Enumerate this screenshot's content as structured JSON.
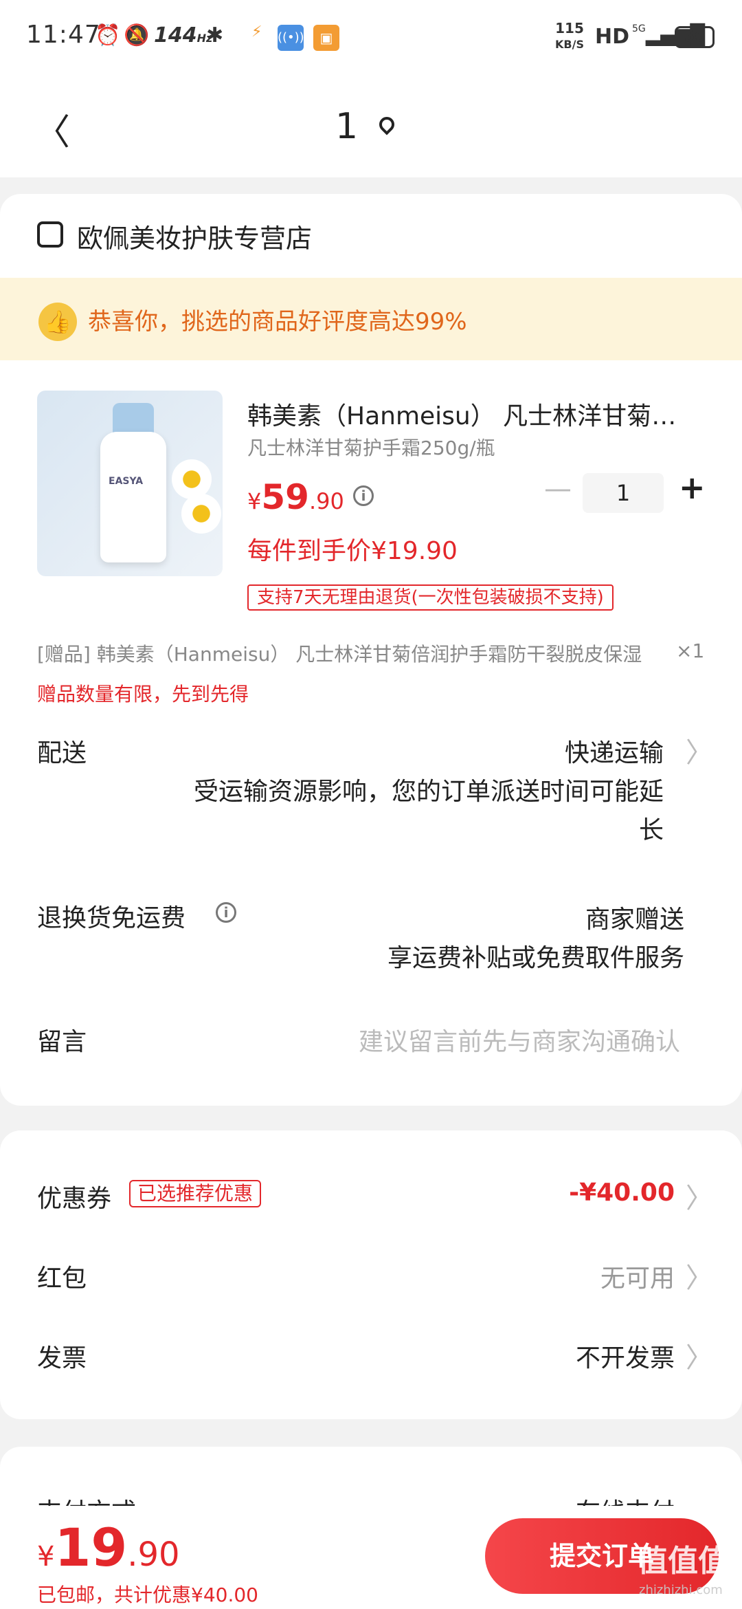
{
  "status_bar": {
    "time": "11:47",
    "refresh": "144",
    "refresh_unit": "Hz",
    "speed_value": "115",
    "speed_unit": "KB/S",
    "hd": "HD",
    "network": "5G",
    "battery": "56"
  },
  "nav": {
    "title": "1"
  },
  "shop": {
    "name": "欧佩美妆护肤专营店"
  },
  "praise": {
    "text": "恭喜你，挑选的商品好评度高达99%"
  },
  "product": {
    "title": "韩美素（Hanmeisu） 凡士林洋甘菊护手霜",
    "spec": "凡士林洋甘菊护手霜250g/瓶",
    "price_currency": "¥",
    "price_int": "59",
    "price_dec": ".90",
    "quantity": "1",
    "unit_price_text": "每件到手价¥19.90",
    "return_policy": "支持7天无理由退货(一次性包装破损不支持)",
    "image_label": "EASYA"
  },
  "gift": {
    "text": "[赠品] 韩美素（Hanmeisu） 凡士林洋甘菊倍润护手霜防干裂脱皮保湿",
    "quantity": "×1",
    "note": "赠品数量有限，先到先得"
  },
  "delivery": {
    "label": "配送",
    "method": "快递运输",
    "notice_line1": "受运输资源影响，您的订单派送时间可能延",
    "notice_line2": "长"
  },
  "return_shipping": {
    "label": "退换货免运费",
    "value": "商家赠送",
    "desc": "享运费补贴或免费取件服务"
  },
  "message": {
    "label": "留言",
    "placeholder": "建议留言前先与商家沟通确认"
  },
  "coupon": {
    "label": "优惠券",
    "tag": "已选推荐优惠",
    "value": "-¥40.00"
  },
  "red_packet": {
    "label": "红包",
    "value": "无可用"
  },
  "invoice": {
    "label": "发票",
    "value": "不开发票"
  },
  "payment": {
    "label": "支付方式",
    "value": "在线支付"
  },
  "bottom": {
    "currency": "¥",
    "total_int": "19",
    "total_dec": ".90",
    "shipping_text": "已包邮，共计优惠¥40.00",
    "submit_label": "提交订单",
    "watermark": "值值值",
    "watermark_url": "zhizhizhi.com"
  },
  "colors": {
    "accent": "#e3272b",
    "praise_bg": "#fdf4da",
    "praise_text": "#e0661b"
  }
}
